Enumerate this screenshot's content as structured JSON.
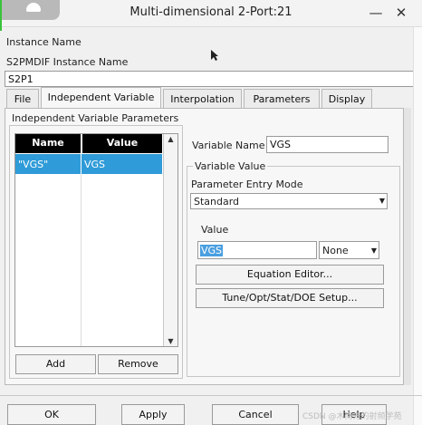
{
  "window": {
    "title": "Multi-dimensional 2-Port:21",
    "minimize_icon": "minimize-icon",
    "close_icon": "close-icon"
  },
  "instance": {
    "section_label": "Instance Name",
    "field_label": "S2PMDIF Instance Name",
    "value": "S2P1"
  },
  "tabs": [
    {
      "label": "File"
    },
    {
      "label": "Independent Variable"
    },
    {
      "label": "Interpolation"
    },
    {
      "label": "Parameters"
    },
    {
      "label": "Display"
    }
  ],
  "independent_variable": {
    "group_title": "Independent Variable Parameters",
    "table": {
      "headers": [
        "Name",
        "Value"
      ],
      "rows": [
        {
          "name": "\"VGS\"",
          "value": "VGS"
        }
      ]
    },
    "add_label": "Add",
    "remove_label": "Remove",
    "variable_name_label": "Variable Name",
    "variable_name_value": "VGS",
    "variable_value_group": "Variable Value",
    "entry_mode_label": "Parameter Entry Mode",
    "entry_mode_value": "Standard",
    "value_label": "Value",
    "value_input": "VGS",
    "unit_value": "None",
    "equation_editor_label": "Equation Editor...",
    "tune_setup_label": "Tune/Opt/Stat/DOE Setup..."
  },
  "footer": {
    "ok_label": "OK",
    "apply_label": "Apply",
    "cancel_label": "Cancel",
    "help_label": "Help"
  },
  "watermark": "CSDN @木南方的射频学苑",
  "colors": {
    "selection": "#2f9bd8",
    "header_bg": "#000000"
  }
}
